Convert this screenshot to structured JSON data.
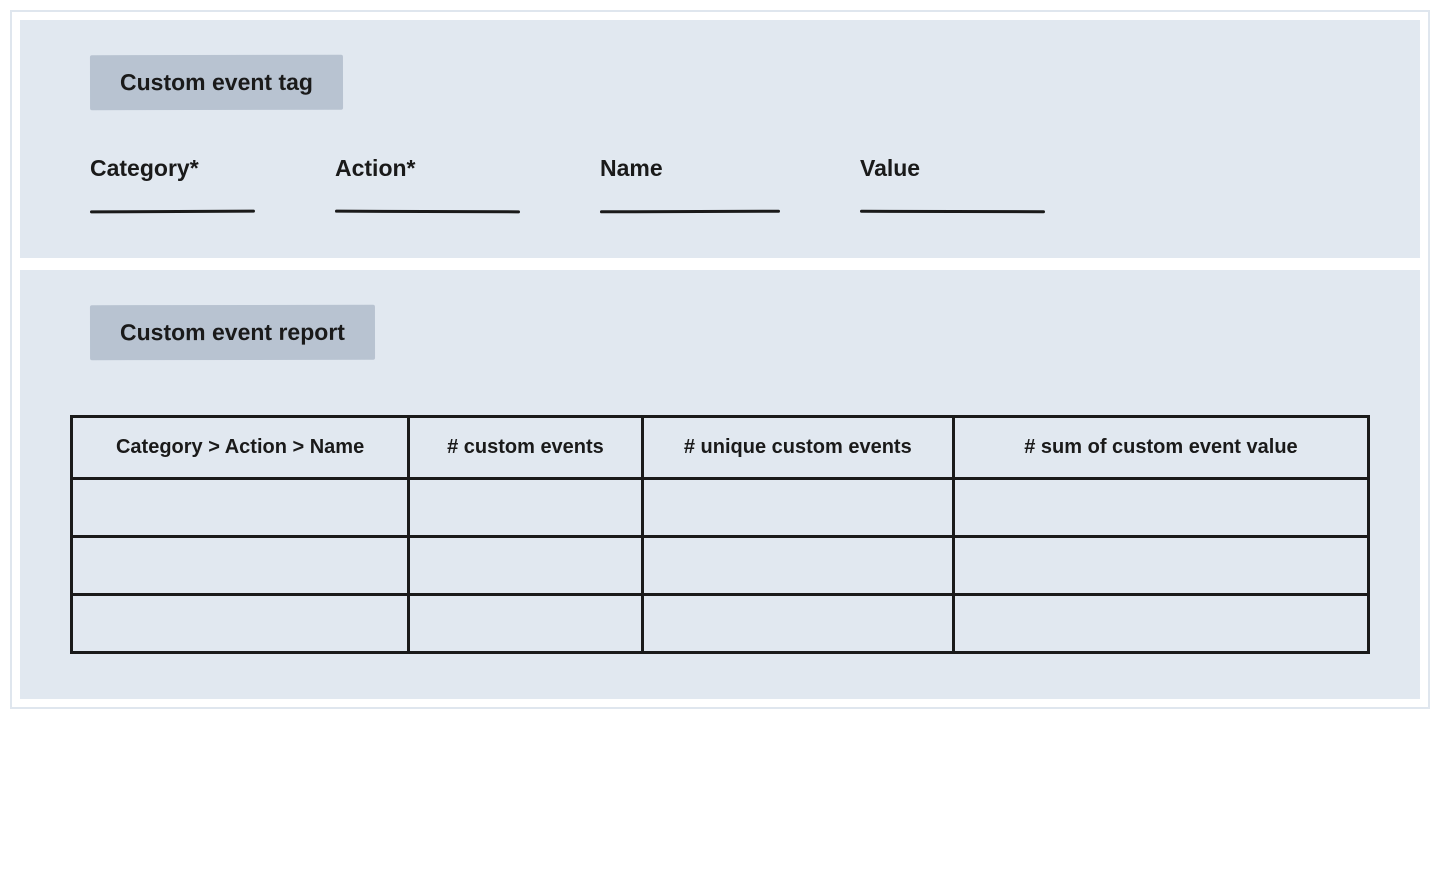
{
  "tag_section": {
    "title": "Custom event tag",
    "fields": [
      {
        "label": "Category*"
      },
      {
        "label": "Action*"
      },
      {
        "label": "Name"
      },
      {
        "label": "Value"
      }
    ]
  },
  "report_section": {
    "title": "Custom event report",
    "columns": [
      "Category > Action > Name",
      "# custom events",
      "# unique custom events",
      "# sum of custom event value"
    ],
    "rows": [
      [
        "",
        "",
        "",
        ""
      ],
      [
        "",
        "",
        "",
        ""
      ],
      [
        "",
        "",
        "",
        ""
      ]
    ]
  }
}
